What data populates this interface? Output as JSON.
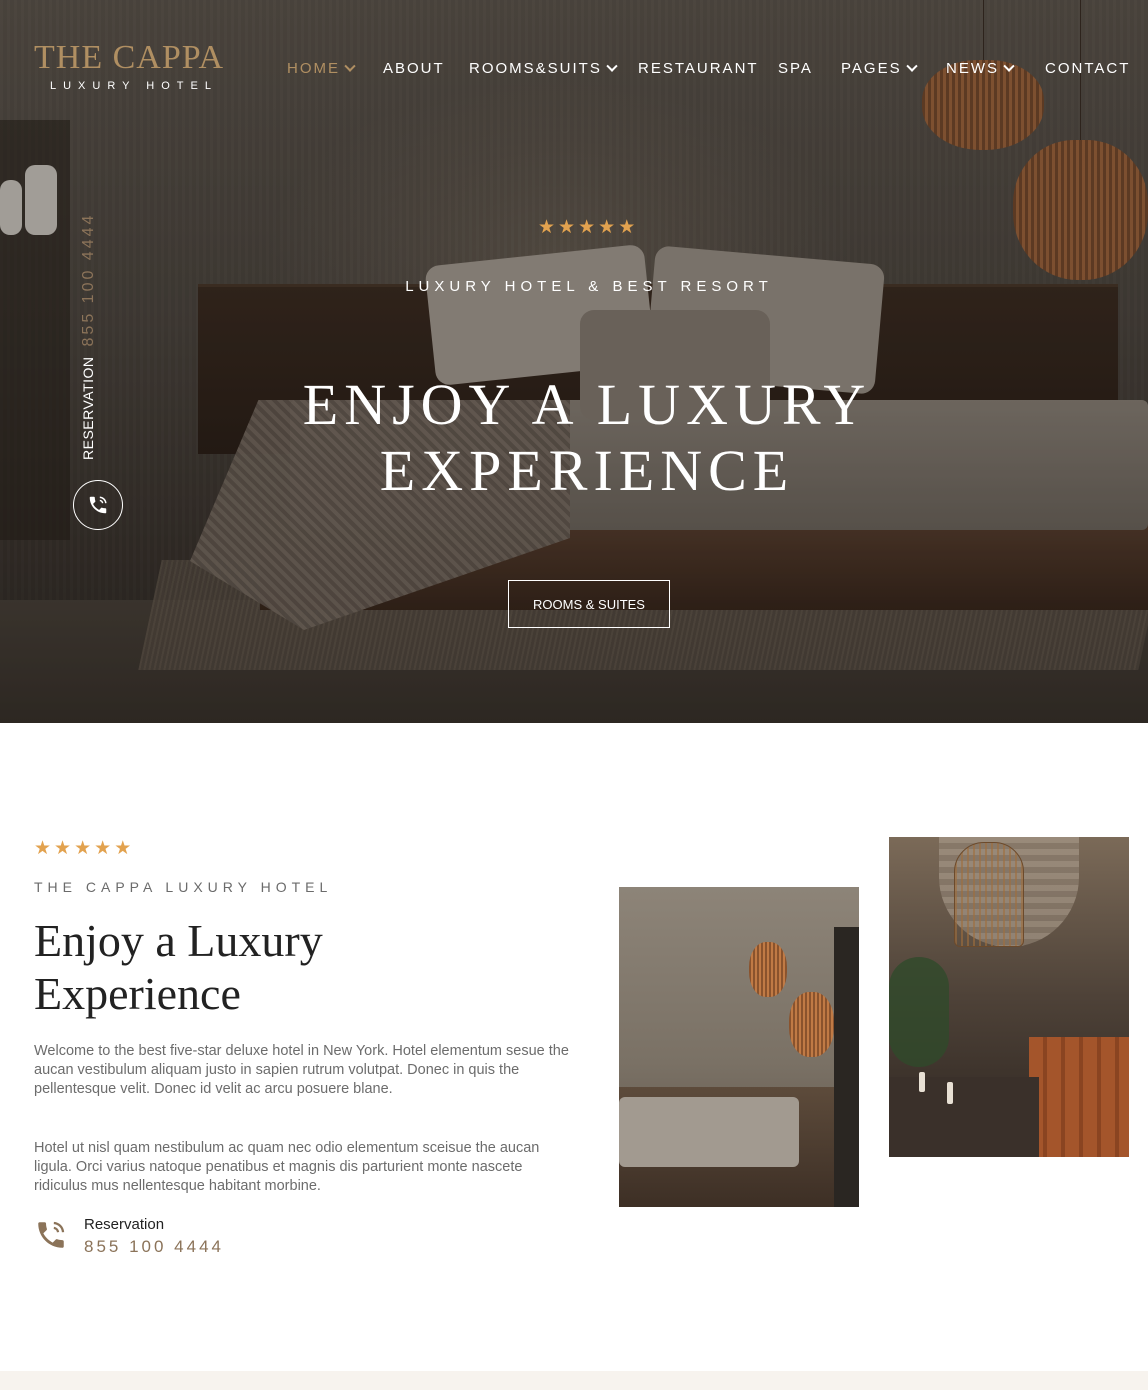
{
  "brand": {
    "name": "THE CAPPA",
    "tagline": "LUXURY HOTEL",
    "accent_color": "#b08f62",
    "star_color": "#e2a24f",
    "phone_color": "#8b7359"
  },
  "nav": {
    "items": [
      {
        "label": "HOME",
        "active": true,
        "has_dropdown": true
      },
      {
        "label": "ABOUT",
        "active": false,
        "has_dropdown": false
      },
      {
        "label": "ROOMS&SUITS",
        "active": false,
        "has_dropdown": true
      },
      {
        "label": "RESTAURANT",
        "active": false,
        "has_dropdown": false
      },
      {
        "label": "SPA",
        "active": false,
        "has_dropdown": false
      },
      {
        "label": "PAGES",
        "active": false,
        "has_dropdown": true
      },
      {
        "label": "NEWS",
        "active": false,
        "has_dropdown": true
      },
      {
        "label": "CONTACT",
        "active": false,
        "has_dropdown": false
      }
    ]
  },
  "hero": {
    "rating_stars": 5,
    "kicker": "LUXURY HOTEL & BEST RESORT",
    "title_line1": "ENJOY A LUXURY",
    "title_line2": "EXPERIENCE",
    "button_label": "ROOMS & SUITES",
    "side_reservation_label": "RESERVATION",
    "side_reservation_number": "855 100 4444",
    "phone_icon": "phone-icon"
  },
  "about": {
    "rating_stars": 5,
    "kicker": "THE CAPPA LUXURY HOTEL",
    "title_line1": "Enjoy a Luxury",
    "title_line2": "Experience",
    "paragraph1": "Welcome to the best five-star deluxe hotel in New York. Hotel elementum sesue the aucan vestibulum aliquam justo in sapien rutrum volutpat. Donec in quis the pellentesque velit. Donec id velit ac arcu posuere blane.",
    "paragraph2": "Hotel ut nisl quam nestibulum ac quam nec odio elementum sceisue the aucan ligula. Orci varius natoque penatibus et magnis dis parturient monte nascete ridiculus mus nellentesque habitant morbine.",
    "reservation_label": "Reservation",
    "reservation_number": "855 100 4444",
    "phone_icon": "phone-icon"
  }
}
